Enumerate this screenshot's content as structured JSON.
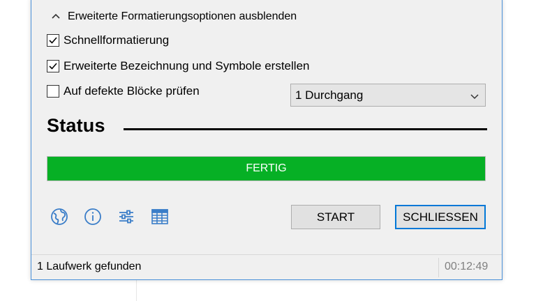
{
  "advanced_toggle": {
    "label": "Erweiterte Formatierungsoptionen ausblenden"
  },
  "options": [
    {
      "label": "Schnellformatierung",
      "checked": true
    },
    {
      "label": "Erweiterte Bezeichnung und Symbole erstellen",
      "checked": true
    },
    {
      "label": "Auf defekte Blöcke prüfen",
      "checked": false
    }
  ],
  "passes_select": {
    "value": "1 Durchgang"
  },
  "status": {
    "title": "Status",
    "progress_label": "FERTIG",
    "progress_fraction": 1.0,
    "progress_color": "#06b025"
  },
  "toolbar_icons": [
    "globe-icon",
    "info-icon",
    "sliders-icon",
    "table-icon"
  ],
  "buttons": {
    "start": "START",
    "close": "SCHLIESSEN"
  },
  "statusbar": {
    "message": "1 Laufwerk gefunden",
    "time": "00:12:49"
  },
  "colors": {
    "accent": "#0078d7",
    "icon": "#3a7dc8"
  }
}
